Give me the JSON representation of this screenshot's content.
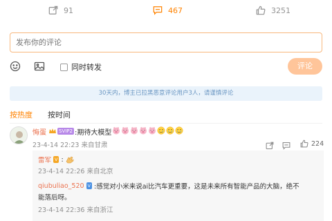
{
  "actions": {
    "forward_count": "91",
    "comment_count": "467",
    "like_count": "3251"
  },
  "composer": {
    "placeholder": "发布你的评论",
    "forward_option": "同时转发",
    "send_label": "评论"
  },
  "notice": "30天内，博主已拉黑恶意评论用户3人，请谨慎评论",
  "sort": {
    "hot": "按热度",
    "time": "按时间"
  },
  "comment": {
    "username": "悔蛋",
    "vip_tag": "SVIP2",
    "text": ":期待大模型",
    "meta": "23-4-14 22:23 来自甘肃",
    "like_count": "224",
    "emoji_names": [
      "pig-face",
      "pig-face",
      "pig-face",
      "pig-face",
      "pig-face",
      "cry-face",
      "cry-face",
      "cry-face"
    ]
  },
  "replies": [
    {
      "username": "雷军",
      "badge": "V",
      "separator": ":",
      "meta": "23-4-14 22:26 来自北京"
    },
    {
      "username": "qiubuliao_520",
      "badge": "V",
      "text": ":感觉对小米来说ai比汽车更重要，这是未来所有智能产品的大脑，绝不",
      "text_cont": "能落后呀。",
      "meta": "23-4-14 22:36 来自浙江"
    }
  ],
  "colors": {
    "accent": "#ff8200",
    "username": "#eb7350",
    "notice_bg": "#eaf3fb",
    "notice_text": "#6a96c2",
    "send_btn": "#ffc59a"
  }
}
